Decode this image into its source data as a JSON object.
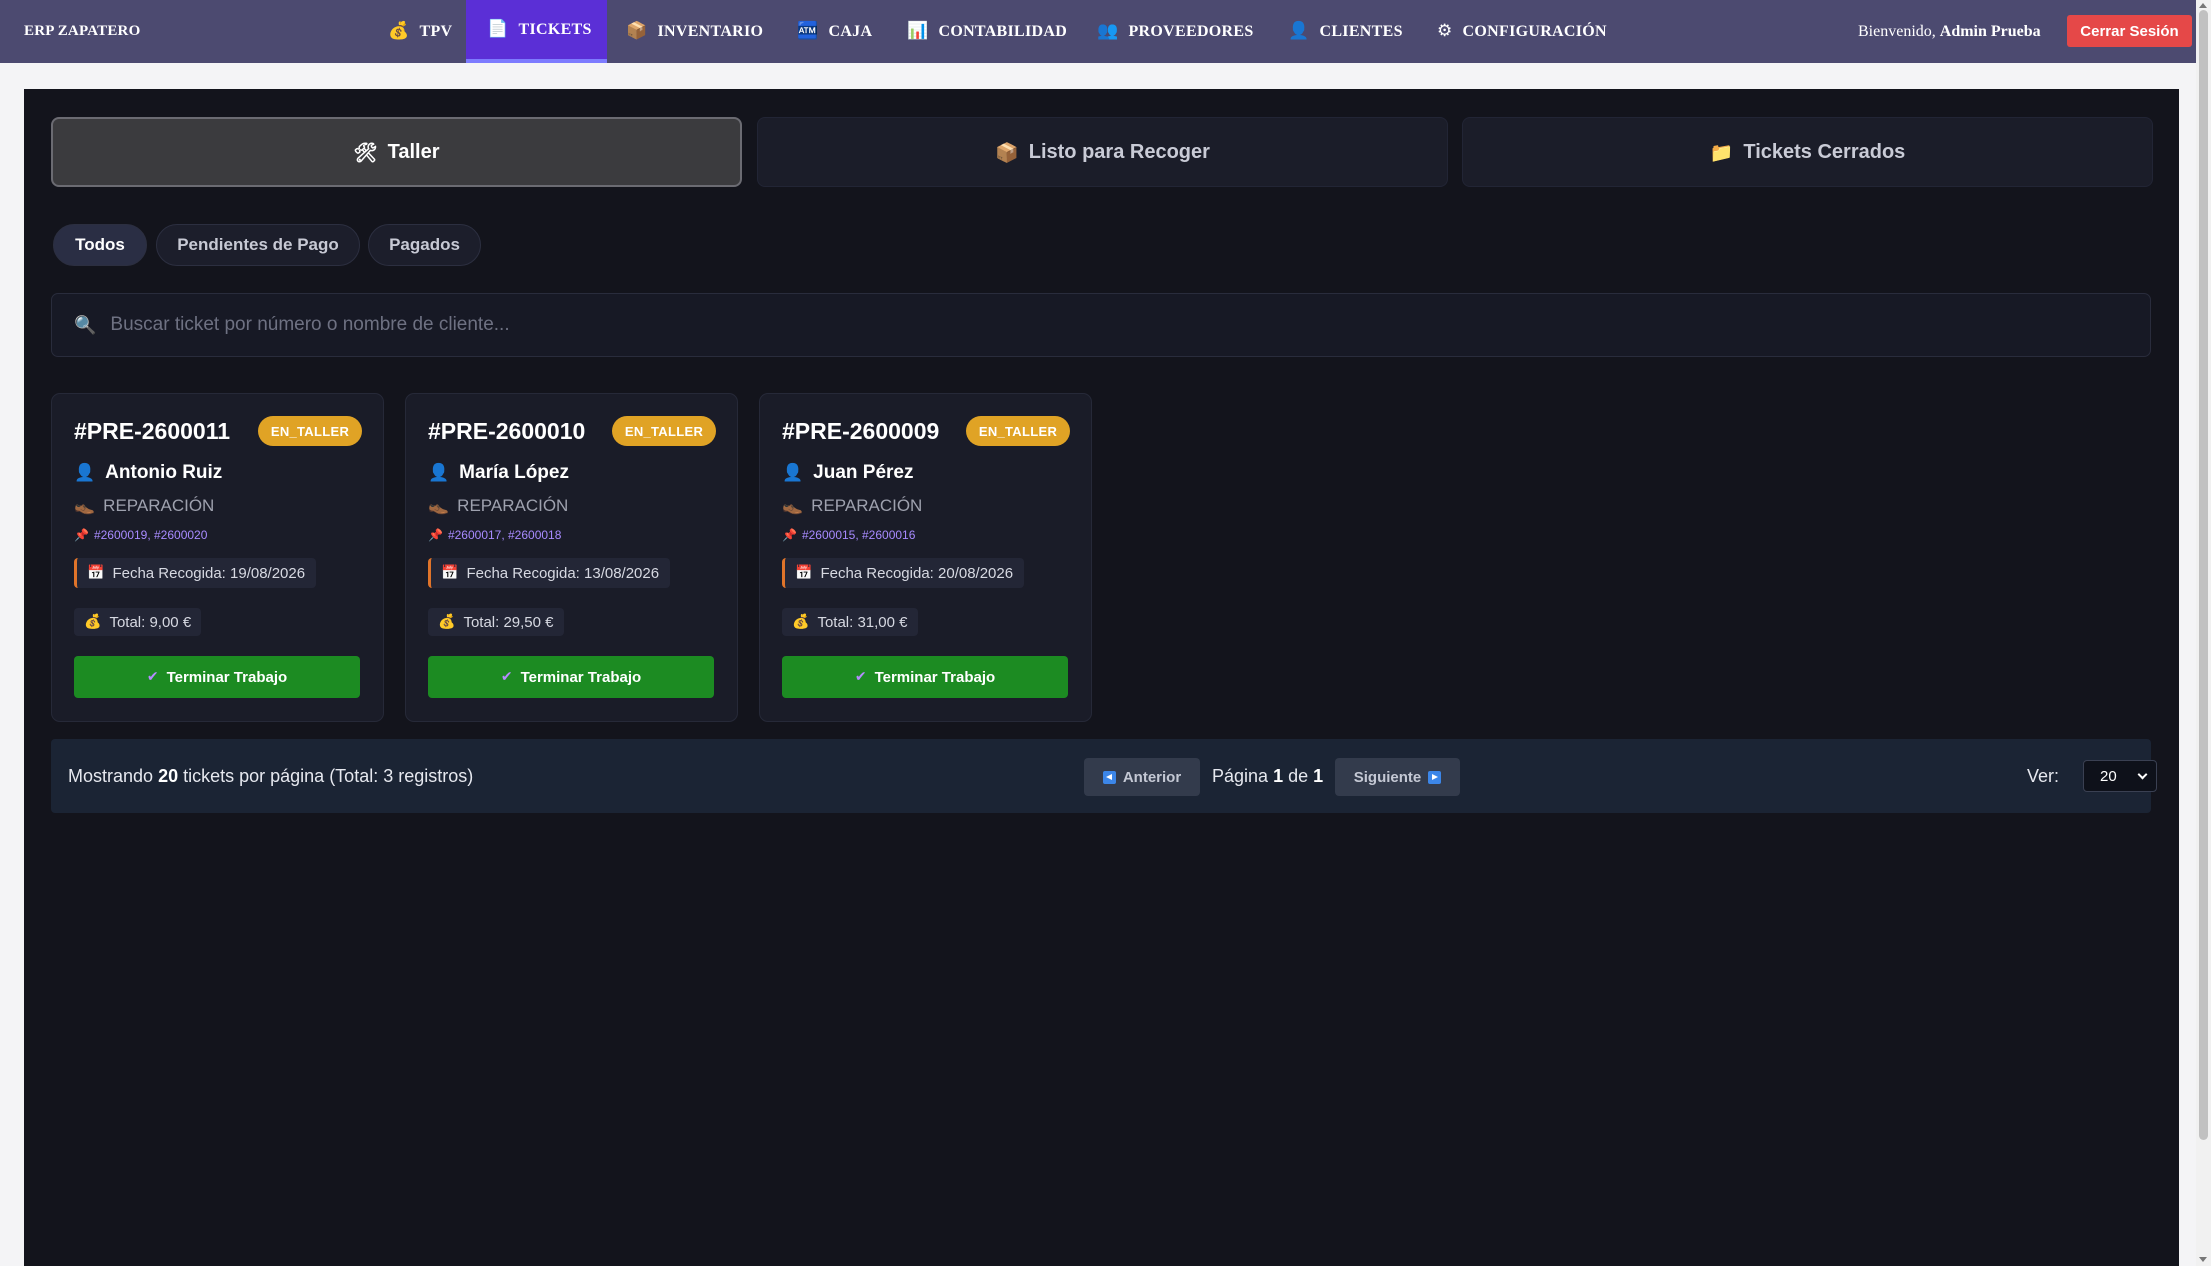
{
  "nav": {
    "brand": "ERP ZAPATERO",
    "items": [
      {
        "label": "TPV",
        "icon": "💰"
      },
      {
        "label": "TICKETS",
        "icon": "📄"
      },
      {
        "label": "INVENTARIO",
        "icon": "📦"
      },
      {
        "label": "CAJA",
        "icon": "🏧"
      },
      {
        "label": "CONTABILIDAD",
        "icon": "📊"
      },
      {
        "label": "PROVEEDORES",
        "icon": "👥"
      },
      {
        "label": "CLIENTES",
        "icon": "👤"
      },
      {
        "label": "CONFIGURACIÓN",
        "icon": "⚙"
      }
    ],
    "active": "TICKETS",
    "welcome_prefix": "Bienvenido,",
    "user_name": "Admin Prueba",
    "logout_label": "Cerrar Sesión"
  },
  "status_tabs": [
    {
      "label": "Taller",
      "icon": "🛠"
    },
    {
      "label": "Listo para Recoger",
      "icon": "📦"
    },
    {
      "label": "Tickets Cerrados",
      "icon": "📁"
    }
  ],
  "filters": [
    "Todos",
    "Pendientes de Pago",
    "Pagados"
  ],
  "search": {
    "placeholder": "Buscar ticket por número o nombre de cliente...",
    "icon": "🔍"
  },
  "tickets": [
    {
      "number": "#PRE-2600011",
      "status": "EN_TALLER",
      "client": "Antonio Ruiz",
      "type": "REPARACIÓN",
      "refs": "#2600019, #2600020",
      "pickup": "Fecha Recogida: 19/08/2026",
      "total": "Total: 9,00 €",
      "action": "Terminar Trabajo"
    },
    {
      "number": "#PRE-2600010",
      "status": "EN_TALLER",
      "client": "María López",
      "type": "REPARACIÓN",
      "refs": "#2600017, #2600018",
      "pickup": "Fecha Recogida: 13/08/2026",
      "total": "Total: 29,50 €",
      "action": "Terminar Trabajo"
    },
    {
      "number": "#PRE-2600009",
      "status": "EN_TALLER",
      "client": "Juan Pérez",
      "type": "REPARACIÓN",
      "refs": "#2600015, #2600016",
      "pickup": "Fecha Recogida: 20/08/2026",
      "total": "Total: 31,00 €",
      "action": "Terminar Trabajo"
    }
  ],
  "pagination": {
    "showing_prefix": "Mostrando",
    "per_page": "20",
    "showing_suffix": "tickets por página (Total: 3 registros)",
    "prev_label": "Anterior",
    "next_label": "Siguiente",
    "page_label": "Página",
    "current_page": "1",
    "of_label": "de",
    "total_pages": "1",
    "ver_label": "Ver:",
    "ver_value": "20"
  },
  "colors": {
    "nav_bg": "#4c4a70",
    "nav_active": "#5b2fd6",
    "logout": "#e54848",
    "badge": "#e0a325",
    "action_button": "#1c8b22",
    "panel_bg": "#13141c"
  }
}
